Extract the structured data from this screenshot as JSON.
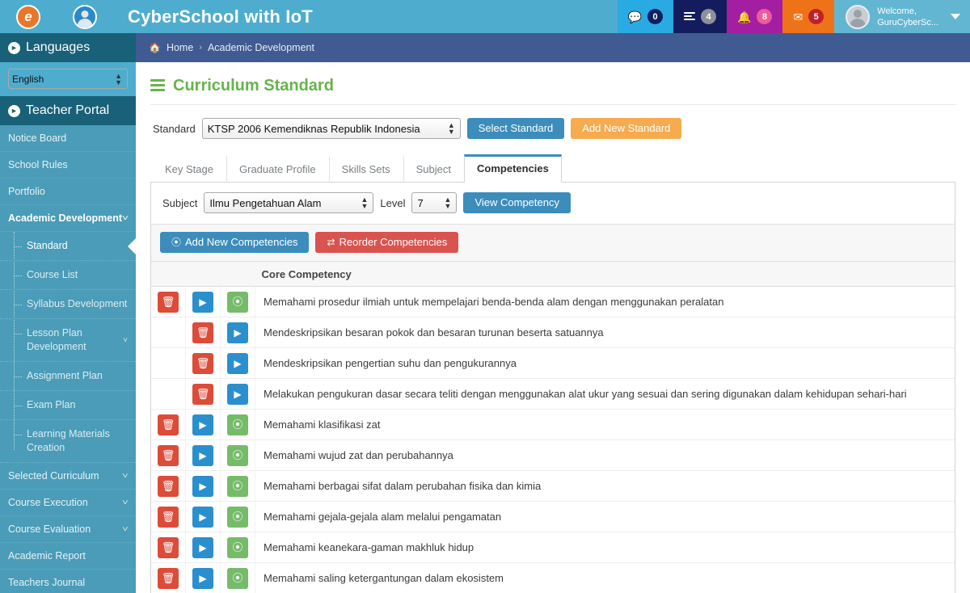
{
  "header": {
    "app_title": "CyberSchool with IoT",
    "logo_primary_icon": "e-logo-icon",
    "logo_secondary_icon": "user-circle-icon",
    "badges": [
      {
        "name": "chat",
        "icon": "chat-icon",
        "count": "0"
      },
      {
        "name": "tasks",
        "icon": "tasks-icon",
        "count": "4"
      },
      {
        "name": "notifications",
        "icon": "bell-icon",
        "count": "8"
      },
      {
        "name": "messages",
        "icon": "envelope-icon",
        "count": "5"
      }
    ],
    "user": {
      "welcome_label": "Welcome,",
      "name": "GuruCyberSc...",
      "avatar_icon": "avatar-icon",
      "caret_icon": "caret-down-icon"
    }
  },
  "breadcrumb": {
    "home_icon": "home-icon",
    "home": "Home",
    "separator": "›",
    "current": "Academic Development"
  },
  "sidebar": {
    "languages": {
      "title": "Languages",
      "bullet_icon": "chevron-right-circle-icon",
      "selected": "English",
      "options": [
        "English"
      ]
    },
    "portal": {
      "title": "Teacher Portal",
      "bullet_icon": "chevron-right-circle-icon"
    },
    "items": [
      {
        "label": "Notice Board",
        "active": false,
        "expandable": false
      },
      {
        "label": "School Rules",
        "active": false,
        "expandable": false
      },
      {
        "label": "Portfolio",
        "active": false,
        "expandable": false
      },
      {
        "label": "Academic Development",
        "active": true,
        "expandable": true
      },
      {
        "label": "Selected Curriculum",
        "active": false,
        "expandable": true
      },
      {
        "label": "Course Execution",
        "active": false,
        "expandable": true
      },
      {
        "label": "Course Evaluation",
        "active": false,
        "expandable": true
      },
      {
        "label": "Academic Report",
        "active": false,
        "expandable": false
      },
      {
        "label": "Teachers Journal",
        "active": false,
        "expandable": false
      }
    ],
    "submenu": [
      {
        "label": "Standard",
        "selected": true,
        "expandable": false
      },
      {
        "label": "Course List",
        "selected": false,
        "expandable": false
      },
      {
        "label": "Syllabus Development",
        "selected": false,
        "expandable": false
      },
      {
        "label": "Lesson Plan Development",
        "selected": false,
        "expandable": true
      },
      {
        "label": "Assignment Plan",
        "selected": false,
        "expandable": false
      },
      {
        "label": "Exam Plan",
        "selected": false,
        "expandable": false
      },
      {
        "label": "Learning Materials Creation",
        "selected": false,
        "expandable": false
      }
    ]
  },
  "main": {
    "title": "Curriculum Standard",
    "title_icon": "list-icon",
    "standard": {
      "label": "Standard",
      "selected": "KTSP 2006 Kemendiknas Republik Indonesia",
      "select_button": "Select Standard",
      "add_button": "Add New Standard"
    },
    "tabs": [
      {
        "label": "Key Stage",
        "active": false
      },
      {
        "label": "Graduate Profile",
        "active": false
      },
      {
        "label": "Skills Sets",
        "active": false
      },
      {
        "label": "Subject",
        "active": false
      },
      {
        "label": "Competencies",
        "active": true
      }
    ],
    "filters": {
      "subject_label": "Subject",
      "subject_selected": "Ilmu Pengetahuan Alam",
      "level_label": "Level",
      "level_selected": "7",
      "view_button": "View Competency"
    },
    "toolbar": {
      "add_label": "Add New Competencies",
      "add_icon": "plus-circle-icon",
      "reorder_label": "Reorder Competencies",
      "reorder_icon": "exchange-icon"
    },
    "table": {
      "header": "Core Competency",
      "row_icons": {
        "delete": "trash-icon",
        "view": "play-icon",
        "add": "plus-circle-icon"
      },
      "rows": [
        {
          "text": "Memahami prosedur ilmiah untuk mempelajari benda-benda alam dengan menggunakan peralatan",
          "level": 0
        },
        {
          "text": "Mendeskripsikan besaran pokok dan besaran turunan beserta satuannya",
          "level": 1
        },
        {
          "text": "Mendeskripsikan pengertian suhu dan pengukurannya",
          "level": 1
        },
        {
          "text": "Melakukan pengukuran dasar secara teliti dengan menggunakan alat ukur yang sesuai dan sering digunakan dalam kehidupan sehari-hari",
          "level": 1
        },
        {
          "text": "Memahami klasifikasi zat",
          "level": 0
        },
        {
          "text": "Memahami wujud zat dan perubahannya",
          "level": 0
        },
        {
          "text": "Memahami berbagai sifat dalam perubahan fisika dan kimia",
          "level": 0
        },
        {
          "text": "Memahami gejala-gejala alam melalui pengamatan",
          "level": 0
        },
        {
          "text": "Memahami keanekara-gaman makhluk hidup",
          "level": 0
        },
        {
          "text": "Memahami saling ketergantungan dalam ekosistem",
          "level": 0
        }
      ]
    }
  },
  "colors": {
    "header_bg": "#4eadce",
    "sidebar_bg": "#4a9cb8",
    "sidebar_section_bg": "#186178",
    "breadcrumb_bg": "#3f5b92",
    "accent_green": "#66b44b",
    "primary_blue": "#3c8dbc",
    "danger_red": "#d9534f",
    "warning_orange": "#f5ab4e"
  }
}
